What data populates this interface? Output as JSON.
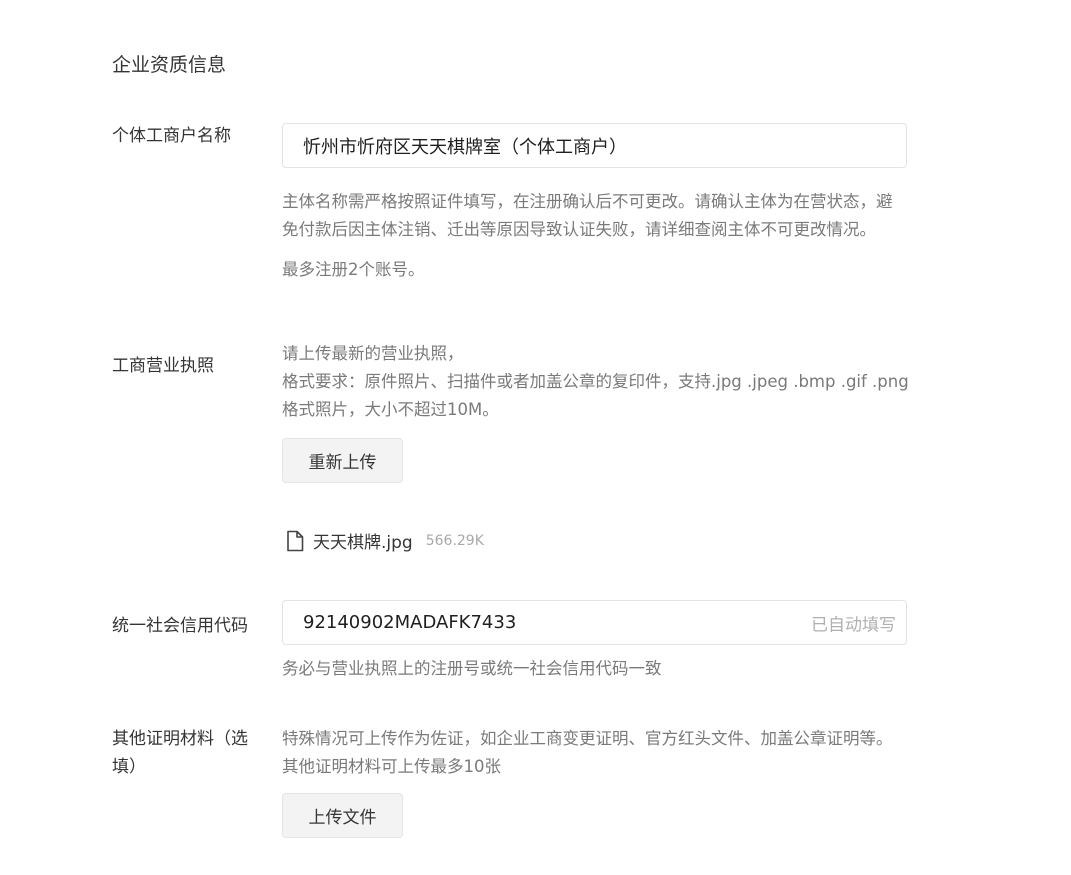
{
  "section": {
    "title": "企业资质信息"
  },
  "business_name": {
    "label": "个体工商户名称",
    "value": "忻州市忻府区天天棋牌室（个体工商户）",
    "hint": "主体名称需严格按照证件填写，在注册确认后不可更改。请确认主体为在营状态，避免付款后因主体注销、迁出等原因导致认证失败，请详细查阅主体不可更改情况。",
    "note": "最多注册2个账号。"
  },
  "license": {
    "label": "工商营业执照",
    "instructions_line1": "请上传最新的营业执照，",
    "instructions_line2": "格式要求：原件照片、扫描件或者加盖公章的复印件，支持.jpg .jpeg .bmp .gif .png格式照片，大小不超过10M。",
    "reupload_button": "重新上传",
    "file": {
      "icon": "document-icon",
      "name": "天天棋牌.jpg",
      "size": "566.29K"
    }
  },
  "credit_code": {
    "label": "统一社会信用代码",
    "value": "92140902MADAFK7433",
    "suffix": "已自动填写",
    "hint": "务必与营业执照上的注册号或统一社会信用代码一致"
  },
  "other_materials": {
    "label": "其他证明材料（选填）",
    "hint": "特殊情况可上传作为佐证，如企业工商变更证明、官方红头文件、加盖公章证明等。其他证明材料可上传最多10张",
    "upload_button": "上传文件"
  }
}
